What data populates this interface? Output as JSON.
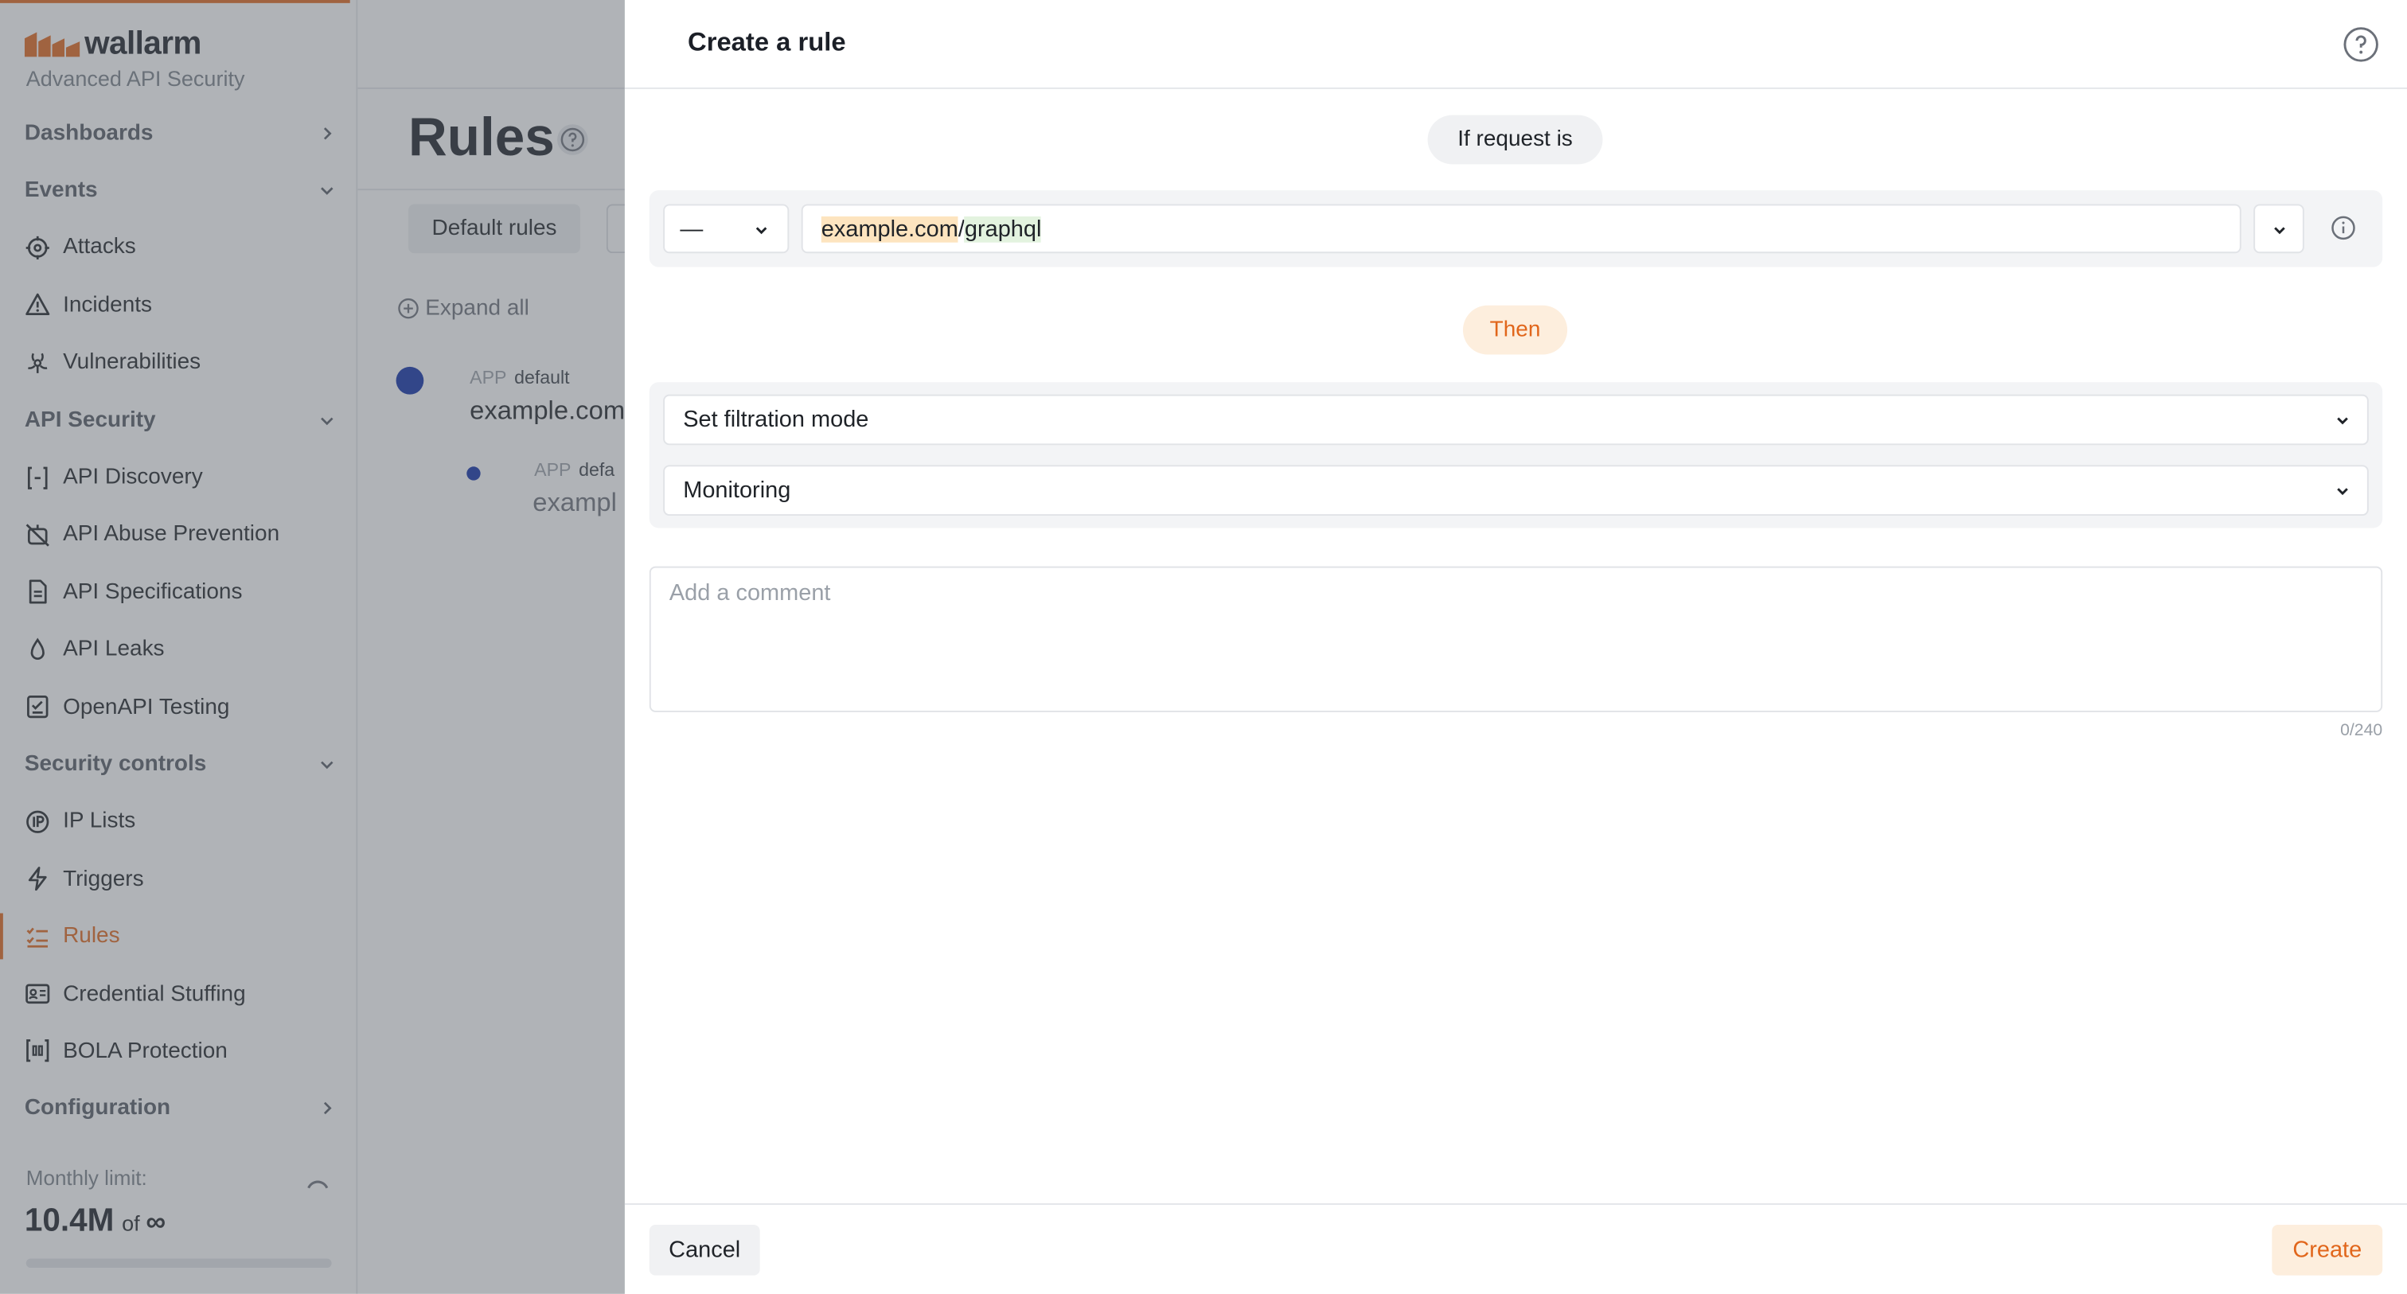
{
  "brand": {
    "name": "wallarm",
    "subtitle": "Advanced API Security",
    "accent_color": "#e1661b"
  },
  "sidebar": {
    "sections": [
      {
        "label": "Dashboards",
        "chevron": "right",
        "items": []
      },
      {
        "label": "Events",
        "chevron": "down",
        "items": [
          {
            "label": "Attacks",
            "icon": "crosshair-icon"
          },
          {
            "label": "Incidents",
            "icon": "warning-icon"
          },
          {
            "label": "Vulnerabilities",
            "icon": "biohazard-icon"
          }
        ]
      },
      {
        "label": "API Security",
        "chevron": "down",
        "items": [
          {
            "label": "API Discovery",
            "icon": "braces-icon"
          },
          {
            "label": "API Abuse Prevention",
            "icon": "robot-off-icon"
          },
          {
            "label": "API Specifications",
            "icon": "document-icon"
          },
          {
            "label": "API Leaks",
            "icon": "drop-icon"
          },
          {
            "label": "OpenAPI Testing",
            "icon": "checklist-icon"
          }
        ]
      },
      {
        "label": "Security controls",
        "chevron": "down",
        "items": [
          {
            "label": "IP Lists",
            "icon": "ip-icon"
          },
          {
            "label": "Triggers",
            "icon": "bolt-icon"
          },
          {
            "label": "Rules",
            "icon": "rules-icon",
            "active": true
          },
          {
            "label": "Credential Stuffing",
            "icon": "id-card-icon"
          },
          {
            "label": "BOLA Protection",
            "icon": "bola-icon"
          }
        ]
      },
      {
        "label": "Configuration",
        "chevron": "right",
        "items": []
      }
    ],
    "monthly_limit": {
      "label": "Monthly limit:",
      "value": "10.4M",
      "of": "of",
      "total": "∞"
    }
  },
  "main": {
    "title": "Rules",
    "tabs": {
      "default_rules": "Default rules"
    },
    "expand_all": "Expand all",
    "tree": [
      {
        "app_label": "APP",
        "app_name": "default",
        "url": "example.com"
      },
      {
        "app_label": "APP",
        "app_name": "defa",
        "url": "exampl"
      }
    ]
  },
  "drawer": {
    "title": "Create a rule",
    "if_label": "If request is",
    "then_label": "Then",
    "condition": {
      "operator": "—",
      "host": "example.com",
      "separator": "/",
      "path": "graphql"
    },
    "action": {
      "type": "Set filtration mode",
      "mode": "Monitoring"
    },
    "comment": {
      "placeholder": "Add a comment",
      "counter": "0/240"
    },
    "footer": {
      "cancel": "Cancel",
      "create": "Create"
    }
  }
}
